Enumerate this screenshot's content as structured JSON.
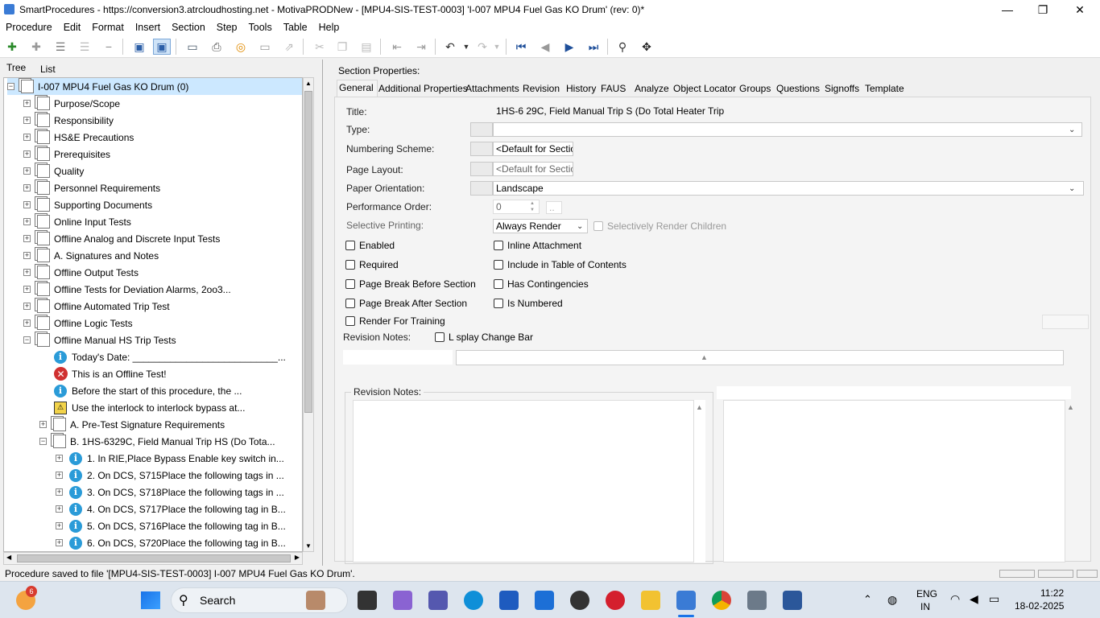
{
  "window": {
    "title": "SmartProcedures - https://conversion3.atrcloudhosting.net - MotivaPRODNew - [MPU4-SIS-TEST-0003] 'I-007 MPU4 Fuel Gas KO Drum' (rev: 0)*",
    "min": "—",
    "max": "❐",
    "close": "✕"
  },
  "menu": [
    "Procedure",
    "Edit",
    "Format",
    "Insert",
    "Section",
    "Step",
    "Tools",
    "Table",
    "Help"
  ],
  "left_tabs": {
    "tree": "Tree",
    "list": "List"
  },
  "tree": {
    "root": "I-007 MPU4 Fuel Gas KO Drum (0)",
    "sections": [
      "Purpose/Scope",
      "Responsibility",
      "HS&E Precautions",
      "Prerequisites",
      "Quality",
      "Personnel Requirements",
      "Supporting Documents",
      "Online Input Tests",
      "Offline Analog and Discrete Input Tests",
      "A. Signatures and Notes",
      "Offline Output Tests",
      "Offline Tests for Deviation Alarms, 2oo3...",
      "Offline Automated Trip Test",
      "Offline Logic Tests",
      "Offline Manual HS Trip Tests"
    ],
    "children": [
      "Today's Date: ___________________________...",
      "This is an Offline Test!",
      "Before the start of this procedure, the ...",
      "Use the interlock to interlock bypass at...",
      "A. Pre-Test Signature Requirements",
      "B. 1HS-6329C, Field Manual Trip HS (Do Tota..."
    ],
    "steps": [
      "1. In RIE,Place Bypass Enable key switch in...",
      "2. On DCS, S715Place the following tags in ...",
      "3. On DCS, S718Place the following tags in ...",
      "4. On DCS, S717Place the following tag in B...",
      "5. On DCS, S716Place the following tag in B...",
      "6. On DCS, S720Place the following tag in B..."
    ]
  },
  "section_properties": {
    "heading": "Section Properties:",
    "tabs": [
      "General",
      "Additional Properties",
      "Attachments",
      "Revision",
      "History",
      "FAUS",
      "Analyze",
      "Object Locator",
      "Groups",
      "Questions",
      "Signoffs",
      "Template"
    ],
    "fields": {
      "title_label": "Title:",
      "title_value": "1HS-6 29C, Field Manual Trip S (Do Total Heater Trip",
      "type_label": "Type:",
      "type_value": "",
      "numbering_label": "Numbering Scheme:",
      "numbering_value": "<Default for Section",
      "page_layout_label": "Page Layout:",
      "page_layout_value": "<Default for Section",
      "orientation_label": "Paper Orientation:",
      "orientation_value": "Landscape",
      "perf_order_label": "Performance Order:",
      "perf_order_value": "0",
      "selective_label": "Selective Printing:",
      "selective_value": "Always Render",
      "selectively_children": "Selectively Render Children"
    },
    "checkboxes_left": [
      "Enabled",
      "Required",
      "Page Break Before Section",
      "Page Break After Section",
      "Render For Training"
    ],
    "checkboxes_right": [
      "Inline Attachment",
      "Include in Table of Contents",
      "Has Contingencies",
      "Is Numbered"
    ],
    "revision_notes_top": "Revision Notes:",
    "display_change_bar": "L splay Change Bar",
    "revision_notes_group": "Revision Notes:"
  },
  "status": "Procedure saved to file '[MPU4-SIS-TEST-0003] I-007 MPU4 Fuel Gas KO Drum'.",
  "taskbar": {
    "search": "Search",
    "notif_badge": "6",
    "lang": "ENG",
    "region": "IN",
    "time": "11:22",
    "date": "18-02-2025"
  }
}
